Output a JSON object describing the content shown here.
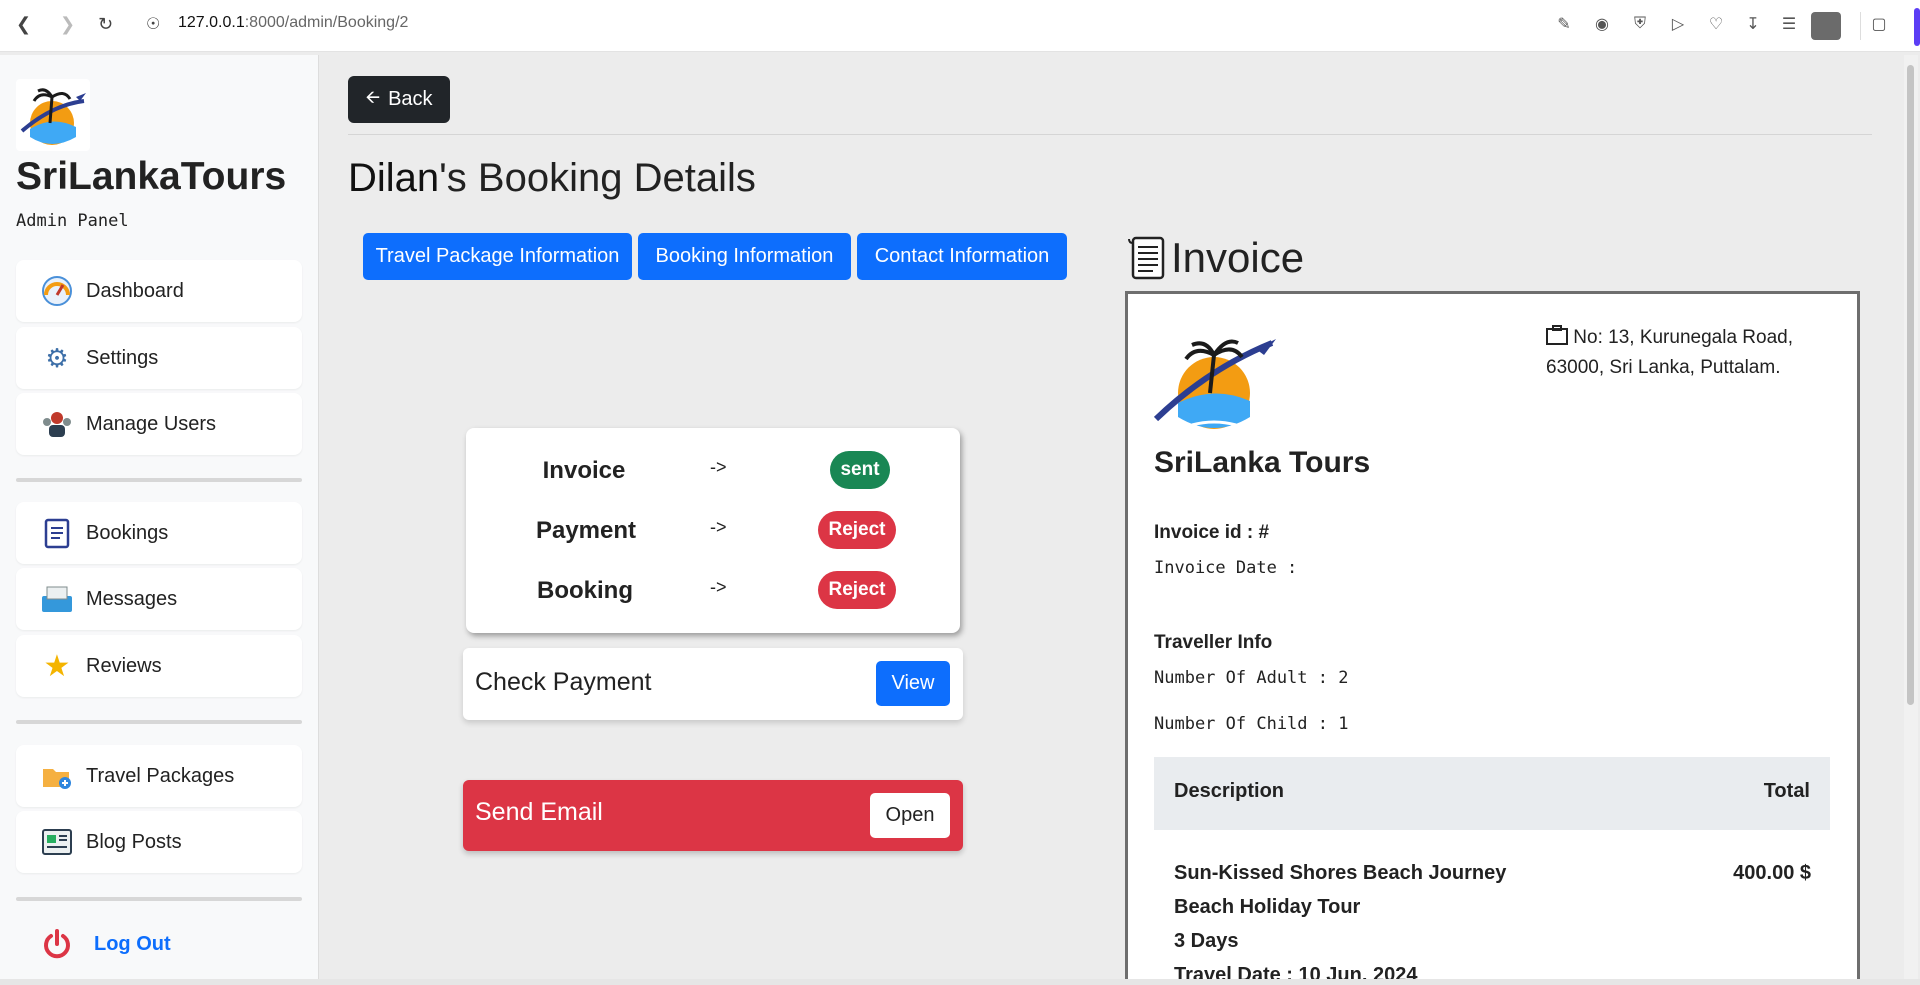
{
  "browser": {
    "url_host": "127.0.0.1",
    "url_path": ":8000/admin/Booking/2"
  },
  "sidebar": {
    "brand": "SriLankaTours",
    "subtitle": "Admin Panel",
    "items": [
      {
        "label": "Dashboard",
        "icon": "speedometer-icon"
      },
      {
        "label": "Settings",
        "icon": "gear-icon"
      },
      {
        "label": "Manage Users",
        "icon": "users-icon"
      },
      {
        "label": "Bookings",
        "icon": "clipboard-icon"
      },
      {
        "label": "Messages",
        "icon": "inbox-icon"
      },
      {
        "label": "Reviews",
        "icon": "star-icon"
      },
      {
        "label": "Travel Packages",
        "icon": "package-folder-icon"
      },
      {
        "label": "Blog Posts",
        "icon": "blog-icon"
      }
    ],
    "logout": "Log Out"
  },
  "main": {
    "back": "Back",
    "title_name": "Dilan",
    "title_rest": "'s Booking Details",
    "tabs": [
      "Travel Package Information",
      "Booking Information",
      "Contact Information"
    ],
    "status": [
      {
        "label": "Invoice",
        "arrow": "->",
        "badge": "sent",
        "color": "#198754"
      },
      {
        "label": "Payment",
        "arrow": "->",
        "badge": "Reject",
        "color": "#dc3545"
      },
      {
        "label": "Booking",
        "arrow": "->",
        "badge": "Reject",
        "color": "#dc3545"
      }
    ],
    "check_payment": {
      "label": "Check Payment",
      "button": "View"
    },
    "send_email": {
      "label": "Send Email",
      "button": "Open"
    }
  },
  "invoice": {
    "heading": "Invoice",
    "address": "No: 13, Kurunegala Road, 63000, Sri Lanka, Puttalam.",
    "brand": "SriLanka Tours",
    "invoice_id": "Invoice id : #",
    "invoice_date": "Invoice Date :",
    "traveller_info": "Traveller Info",
    "adults": "Number Of Adult : 2",
    "children": "Number Of Child : 1",
    "table": {
      "col_desc": "Description",
      "col_total": "Total"
    },
    "item": {
      "name": "Sun-Kissed Shores Beach Journey",
      "type": "Beach Holiday Tour",
      "duration": "3 Days",
      "travel_date": "Travel Date : 10 Jun, 2024",
      "price": "400.00 $"
    }
  }
}
